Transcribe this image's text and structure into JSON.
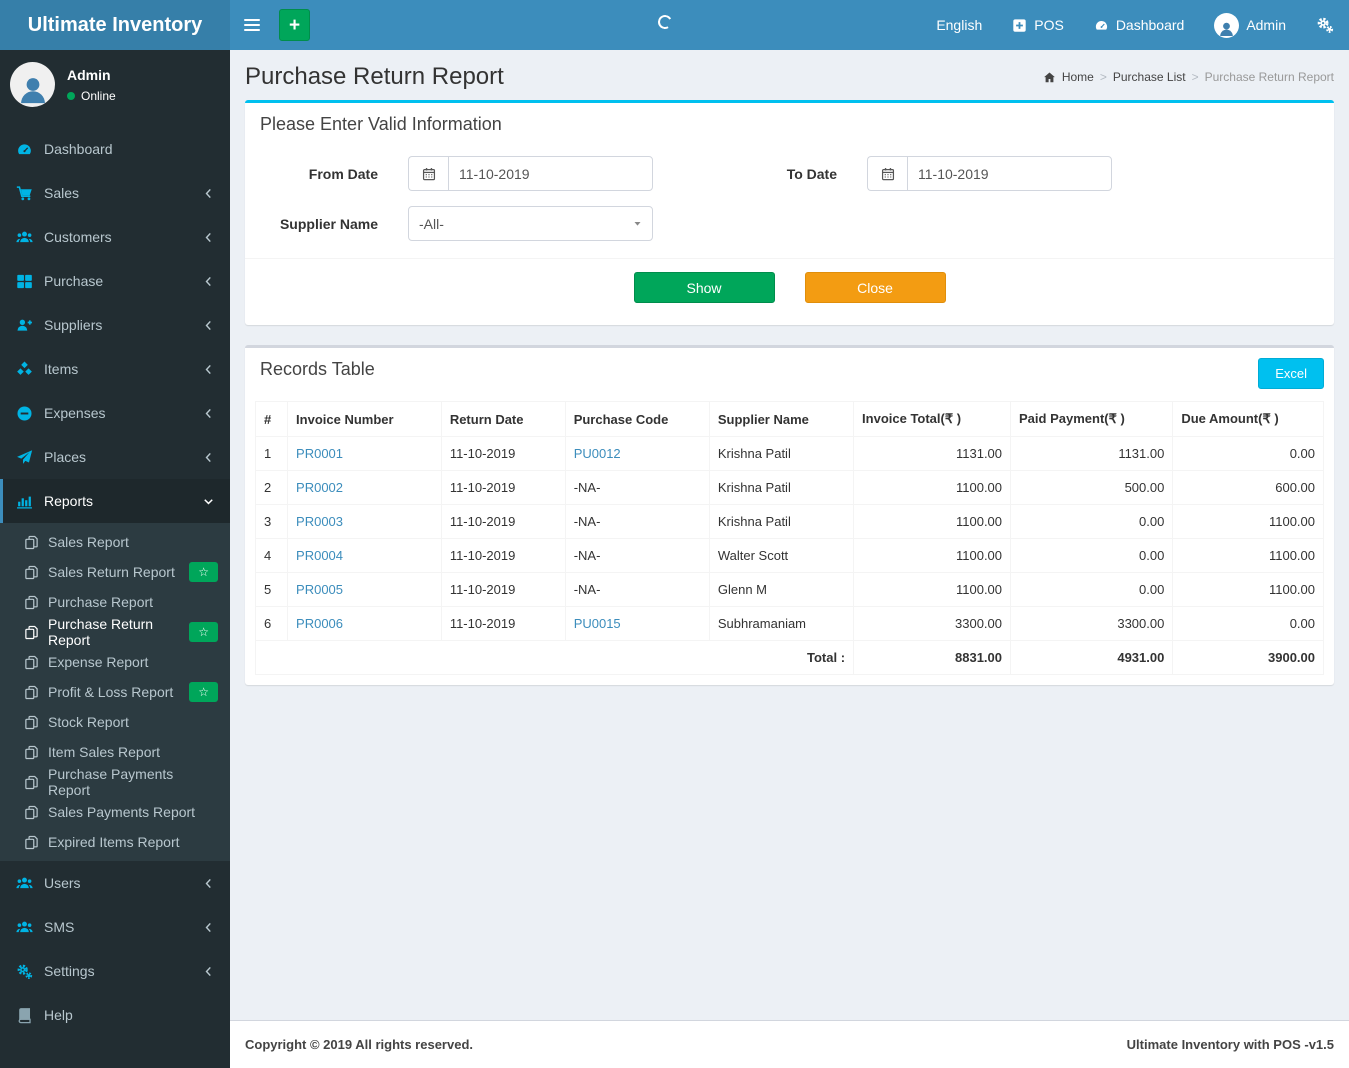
{
  "app": {
    "brand": "Ultimate Inventory"
  },
  "navbar": {
    "links": {
      "language": "English",
      "pos": "POS",
      "pos_icon": "plus-square-icon",
      "dashboard": "Dashboard",
      "dashboard_icon": "gauge-icon",
      "user": "Admin",
      "user_icon": "user-avatar-icon",
      "settings_icon": "gears-icon"
    }
  },
  "user_panel": {
    "name": "Admin",
    "status": "Online"
  },
  "sidebar": {
    "badge_char": "☆",
    "items": [
      {
        "label": "Dashboard",
        "icon": "gauge",
        "chevron": ""
      },
      {
        "label": "Sales",
        "icon": "cart",
        "chevron": "left"
      },
      {
        "label": "Customers",
        "icon": "users",
        "chevron": "left"
      },
      {
        "label": "Purchase",
        "icon": "grid",
        "chevron": "left"
      },
      {
        "label": "Suppliers",
        "icon": "user-plus",
        "chevron": "left"
      },
      {
        "label": "Items",
        "icon": "cubes",
        "chevron": "left"
      },
      {
        "label": "Expenses",
        "icon": "minus-circle",
        "chevron": "left"
      },
      {
        "label": "Places",
        "icon": "paper-plane",
        "chevron": "left"
      },
      {
        "label": "Reports",
        "icon": "bar-chart",
        "chevron": "down",
        "active": true,
        "submenu": [
          {
            "label": "Sales Report"
          },
          {
            "label": "Sales Return Report",
            "badge": "star"
          },
          {
            "label": "Purchase Report"
          },
          {
            "label": "Purchase Return Report",
            "active": true,
            "badge": "star"
          },
          {
            "label": "Expense Report"
          },
          {
            "label": "Profit & Loss Report",
            "badge": "star"
          },
          {
            "label": "Stock Report"
          },
          {
            "label": "Item Sales Report"
          },
          {
            "label": "Purchase Payments Report"
          },
          {
            "label": "Sales Payments Report"
          },
          {
            "label": "Expired Items Report"
          }
        ]
      },
      {
        "label": "Users",
        "icon": "users",
        "chevron": "left"
      },
      {
        "label": "SMS",
        "icon": "users",
        "chevron": "left"
      },
      {
        "label": "Settings",
        "icon": "gears",
        "chevron": "left"
      },
      {
        "label": "Help",
        "icon": "book",
        "chevron": "",
        "icon_color": "#8aa4af"
      }
    ]
  },
  "page": {
    "title": "Purchase Return Report",
    "breadcrumb": {
      "home": "Home",
      "section": "Purchase List",
      "current": "Purchase Return Report"
    }
  },
  "filter": {
    "panel_title": "Please Enter Valid Information",
    "from_date": {
      "label": "From Date",
      "value": "11-10-2019"
    },
    "to_date": {
      "label": "To Date",
      "value": "11-10-2019"
    },
    "supplier": {
      "label": "Supplier Name",
      "value": "-All-"
    },
    "show_button": "Show",
    "close_button": "Close"
  },
  "records": {
    "panel_title": "Records Table",
    "excel_button": "Excel",
    "columns": [
      "#",
      "Invoice Number",
      "Return Date",
      "Purchase Code",
      "Supplier Name",
      "Invoice Total(₹ )",
      "Paid Payment(₹ )",
      "Due Amount(₹ )"
    ],
    "rows": [
      {
        "sn": "1",
        "invoice": "PR0001",
        "date": "11-10-2019",
        "code": "PU0012",
        "code_link": true,
        "supplier": "Krishna Patil",
        "total": "1131.00",
        "paid": "1131.00",
        "due": "0.00"
      },
      {
        "sn": "2",
        "invoice": "PR0002",
        "date": "11-10-2019",
        "code": "-NA-",
        "code_link": false,
        "supplier": "Krishna Patil",
        "total": "1100.00",
        "paid": "500.00",
        "due": "600.00"
      },
      {
        "sn": "3",
        "invoice": "PR0003",
        "date": "11-10-2019",
        "code": "-NA-",
        "code_link": false,
        "supplier": "Krishna Patil",
        "total": "1100.00",
        "paid": "0.00",
        "due": "1100.00"
      },
      {
        "sn": "4",
        "invoice": "PR0004",
        "date": "11-10-2019",
        "code": "-NA-",
        "code_link": false,
        "supplier": "Walter Scott",
        "total": "1100.00",
        "paid": "0.00",
        "due": "1100.00"
      },
      {
        "sn": "5",
        "invoice": "PR0005",
        "date": "11-10-2019",
        "code": "-NA-",
        "code_link": false,
        "supplier": "Glenn M",
        "total": "1100.00",
        "paid": "0.00",
        "due": "1100.00"
      },
      {
        "sn": "6",
        "invoice": "PR0006",
        "date": "11-10-2019",
        "code": "PU0015",
        "code_link": true,
        "supplier": "Subhramaniam",
        "total": "3300.00",
        "paid": "3300.00",
        "due": "0.00"
      }
    ],
    "total": {
      "label": "Total :",
      "total": "8831.00",
      "paid": "4931.00",
      "due": "3900.00"
    }
  },
  "footer": {
    "left": "Copyright © 2019 All rights reserved.",
    "right": "Ultimate Inventory with POS -v1.5"
  },
  "colors": {
    "navbar": "#3c8dbc",
    "logo_bg": "#367fa9",
    "sidebar_bg": "#222d32",
    "submenu_bg": "#2c3b41",
    "active_item_bg": "#1e282c",
    "sidebar_icon": "#00b4e4",
    "green": "#00a65a",
    "orange": "#f39c12",
    "aqua": "#00c0ef",
    "link": "#3c8dbc",
    "content_bg": "#ecf0f5"
  }
}
